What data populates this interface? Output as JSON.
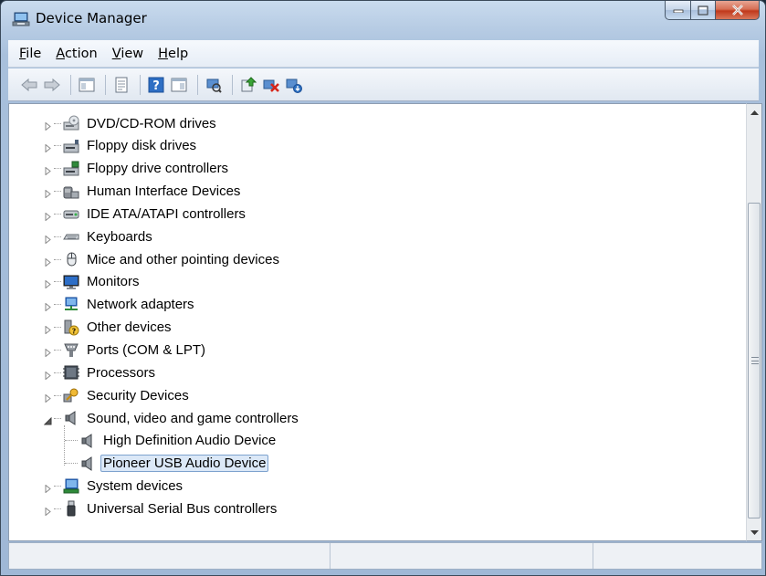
{
  "window": {
    "title": "Device Manager",
    "accent": "#b7cce4"
  },
  "menu": {
    "items": [
      {
        "label": "ile",
        "mnemonic": "F"
      },
      {
        "label": "ction",
        "mnemonic": "A"
      },
      {
        "label": "iew",
        "mnemonic": "V"
      },
      {
        "label": "elp",
        "mnemonic": "H"
      }
    ]
  },
  "toolbar": {
    "buttons": [
      "back-arrow-icon",
      "forward-arrow-icon",
      "show-hide-console-tree-icon",
      "properties-icon",
      "help-icon",
      "action-pane-icon",
      "scan-hardware-icon",
      "update-driver-icon",
      "disable-device-icon",
      "uninstall-device-icon"
    ]
  },
  "tree": {
    "rows": [
      {
        "label": "DVD/CD-ROM drives",
        "icon": "dvd-drive-icon",
        "expanded": false
      },
      {
        "label": "Floppy disk drives",
        "icon": "floppy-disk-icon",
        "expanded": false
      },
      {
        "label": "Floppy drive controllers",
        "icon": "floppy-controller-icon",
        "expanded": false
      },
      {
        "label": "Human Interface Devices",
        "icon": "hid-icon",
        "expanded": false
      },
      {
        "label": "IDE ATA/ATAPI controllers",
        "icon": "ide-controller-icon",
        "expanded": false
      },
      {
        "label": "Keyboards",
        "icon": "keyboard-icon",
        "expanded": false
      },
      {
        "label": "Mice and other pointing devices",
        "icon": "mouse-icon",
        "expanded": false
      },
      {
        "label": "Monitors",
        "icon": "monitor-icon",
        "expanded": false
      },
      {
        "label": "Network adapters",
        "icon": "network-adapter-icon",
        "expanded": false
      },
      {
        "label": "Other devices",
        "icon": "other-devices-icon",
        "expanded": false
      },
      {
        "label": "Ports (COM & LPT)",
        "icon": "ports-icon",
        "expanded": false
      },
      {
        "label": "Processors",
        "icon": "processor-icon",
        "expanded": false
      },
      {
        "label": "Security Devices",
        "icon": "security-key-icon",
        "expanded": false
      },
      {
        "label": "Sound, video and game controllers",
        "icon": "speaker-icon",
        "expanded": true
      },
      {
        "label": "High Definition Audio Device",
        "icon": "speaker-icon",
        "child": true
      },
      {
        "label": "Pioneer USB Audio Device",
        "icon": "speaker-icon",
        "child": true,
        "selected": true
      },
      {
        "label": "System devices",
        "icon": "system-devices-icon",
        "expanded": false
      },
      {
        "label": "Universal Serial Bus controllers",
        "icon": "usb-icon",
        "expanded": false
      }
    ]
  }
}
